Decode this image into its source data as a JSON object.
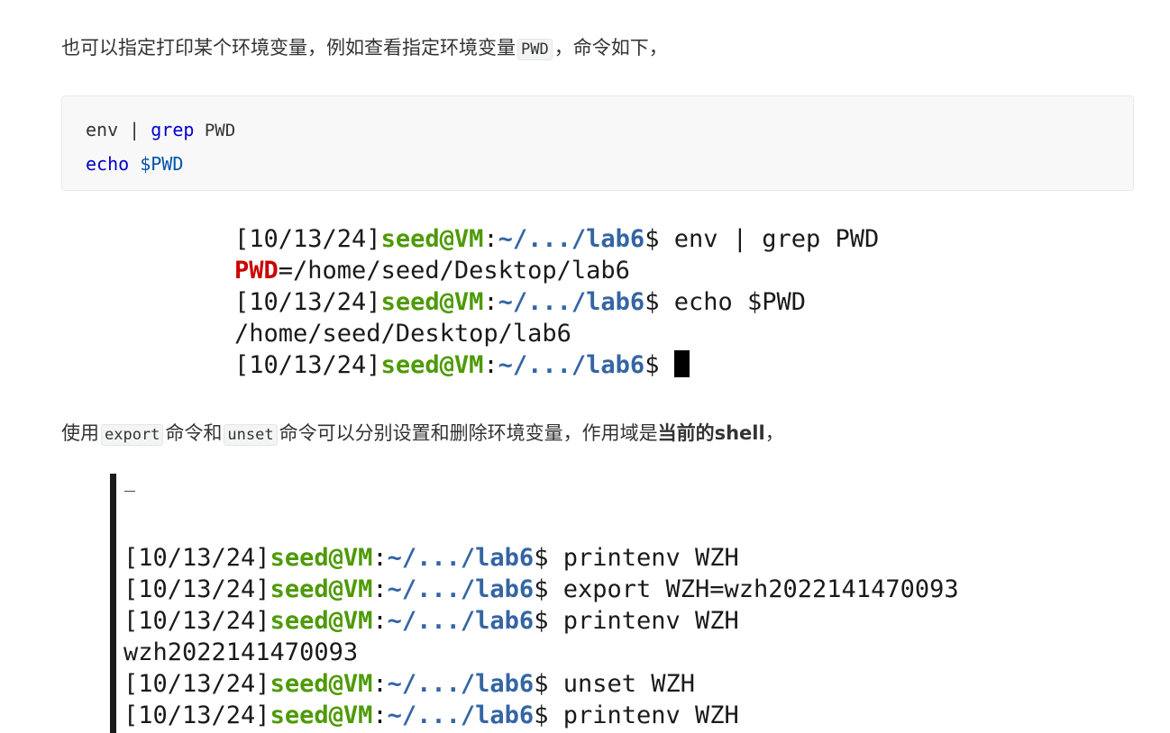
{
  "para1": {
    "before": "也可以指定打印某个环境变量，例如查看指定环境变量",
    "code": "PWD",
    "after": "，命令如下，"
  },
  "code_block": {
    "line1": {
      "cmd": "env",
      "pipe": " | ",
      "grep": "grep",
      "arg": " PWD"
    },
    "line2": {
      "cmd": "echo",
      "space": " ",
      "var": "$PWD"
    }
  },
  "terminal1": {
    "prompt_date": "[10/13/24]",
    "prompt_user": "seed@VM",
    "prompt_colon": ":",
    "prompt_path": "~/.../lab6",
    "prompt_dollar": "$ ",
    "lines": [
      {
        "type": "prompt",
        "cmd": "env | grep PWD"
      },
      {
        "type": "env",
        "name": "PWD",
        "value": "=/home/seed/Desktop/lab6"
      },
      {
        "type": "prompt",
        "cmd": "echo $PWD"
      },
      {
        "type": "output",
        "text": "/home/seed/Desktop/lab6"
      },
      {
        "type": "prompt",
        "cmd": ""
      }
    ]
  },
  "para2": {
    "t1": "使用",
    "code1": "export",
    "t2": "命令和",
    "code2": "unset",
    "t3": "命令可以分别设置和删除环境变量，作用域是",
    "bold": "当前的shell",
    "t4": "，"
  },
  "terminal2": {
    "top_mark": "_",
    "lines": [
      {
        "type": "prompt",
        "cmd": "printenv WZH"
      },
      {
        "type": "prompt",
        "cmd": "export WZH=wzh2022141470093"
      },
      {
        "type": "prompt",
        "cmd": "printenv WZH"
      },
      {
        "type": "output",
        "text": "wzh2022141470093"
      },
      {
        "type": "prompt",
        "cmd": "unset WZH"
      },
      {
        "type": "prompt",
        "cmd": "printenv WZH"
      },
      {
        "type": "prompt",
        "cmd": ""
      }
    ]
  },
  "colors": {
    "prompt_user": "#4e9a06",
    "prompt_path": "#3465a4",
    "env_name": "#cc0000",
    "keyword": "#0000cc"
  }
}
